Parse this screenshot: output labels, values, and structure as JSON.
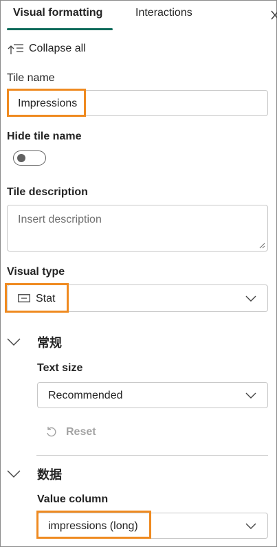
{
  "tabs": [
    {
      "label": "Visual formatting"
    },
    {
      "label": "Interactions"
    }
  ],
  "collapse_all_label": "Collapse all",
  "tile_name": {
    "label": "Tile name",
    "value": "Impressions"
  },
  "hide_tile_name": {
    "label": "Hide tile name",
    "on": false
  },
  "tile_description": {
    "label": "Tile description",
    "placeholder": "Insert description"
  },
  "visual_type": {
    "label": "Visual type",
    "value": "Stat"
  },
  "general_section": {
    "title": "常规",
    "text_size": {
      "label": "Text size",
      "value": "Recommended"
    },
    "reset_label": "Reset"
  },
  "data_section": {
    "title": "数据",
    "value_column": {
      "label": "Value column",
      "value": "impressions (long)"
    }
  },
  "colors": {
    "accent": "#0f6b5b",
    "highlight": "#ef8a20",
    "border": "#c7c7c7"
  },
  "icons": [
    "collapse-all-icon",
    "close-icon",
    "chevron-down-icon",
    "stat-card-icon",
    "reset-icon"
  ]
}
